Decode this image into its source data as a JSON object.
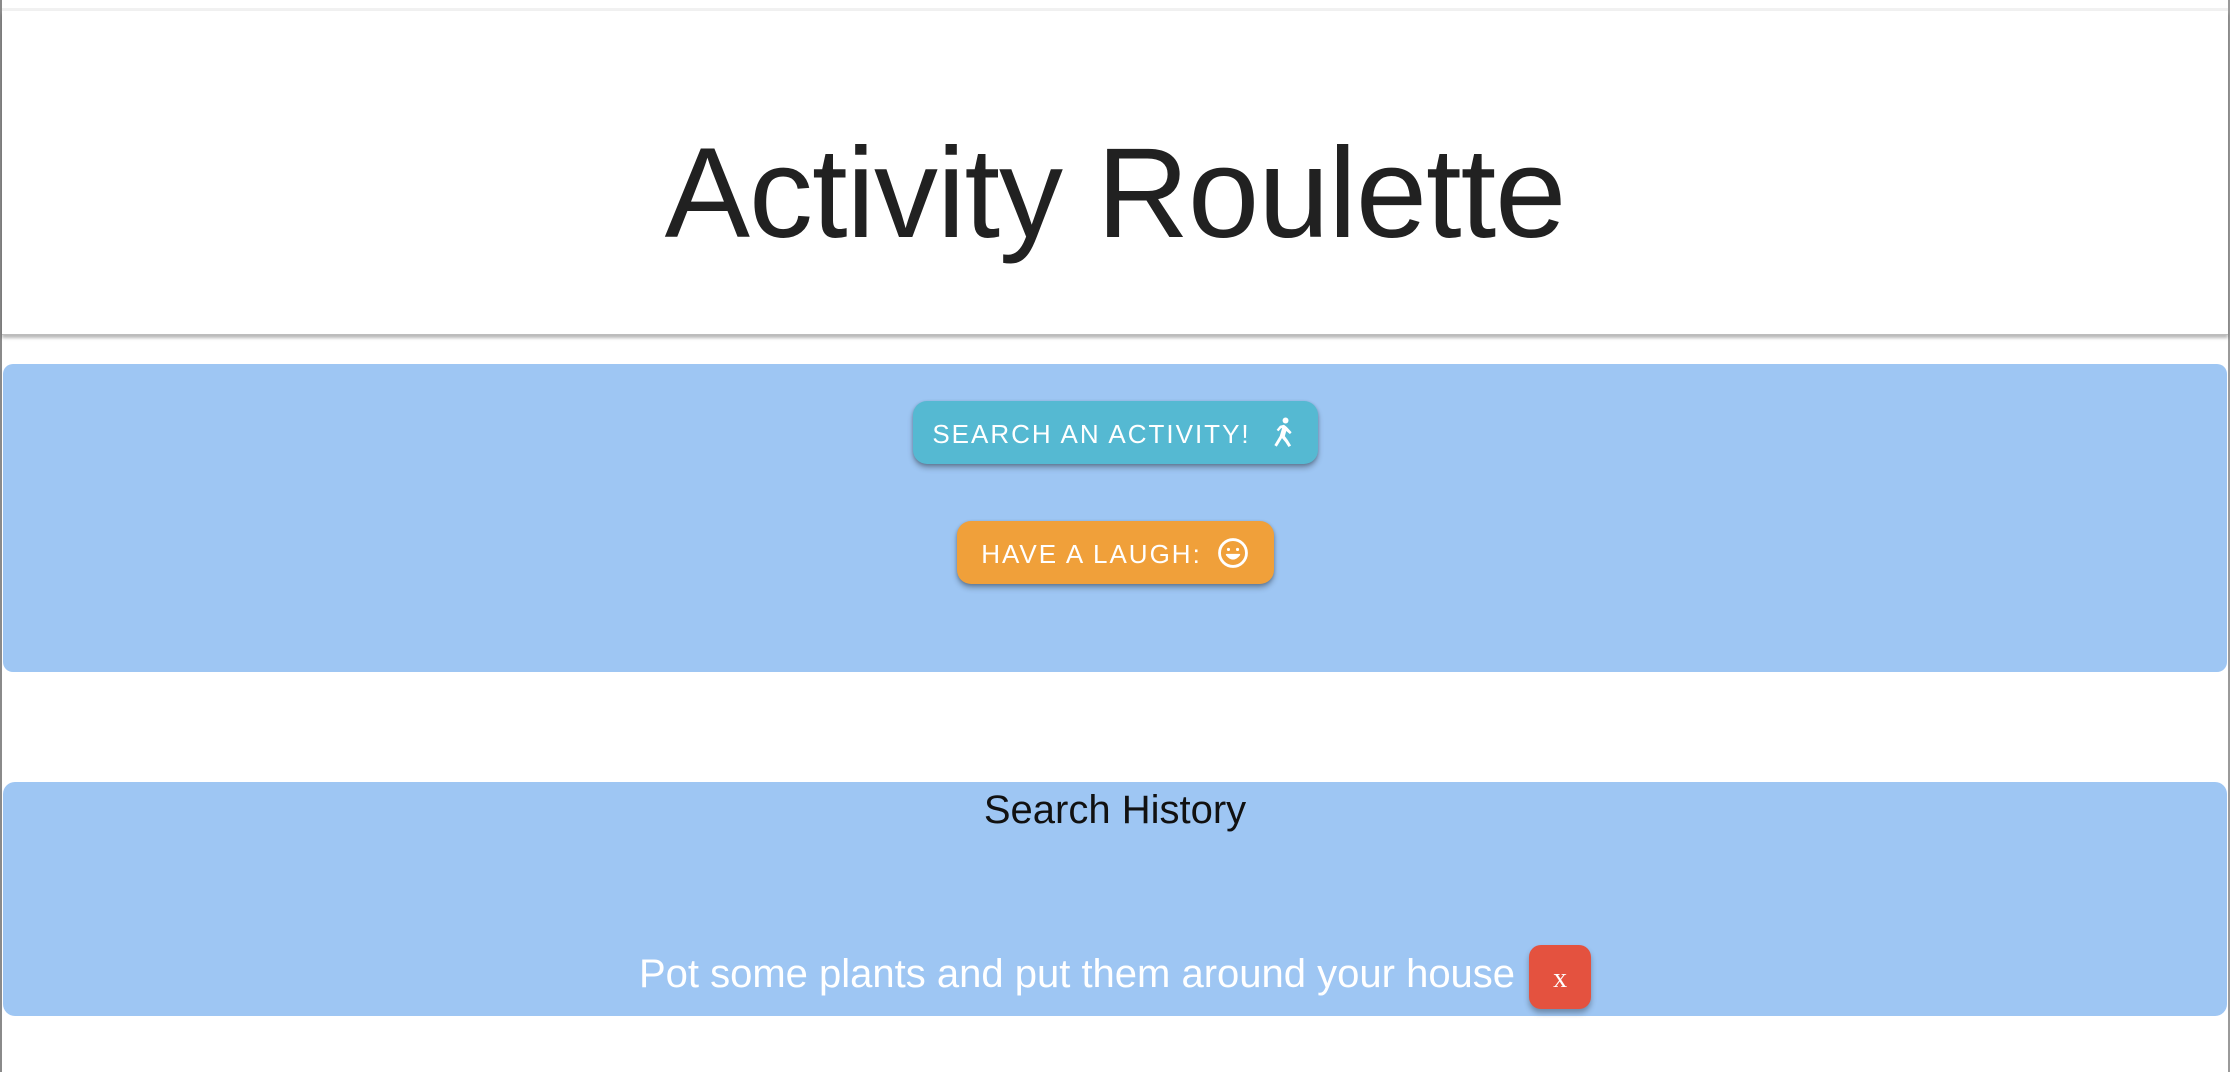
{
  "app": {
    "title": "Activity Roulette"
  },
  "actions": {
    "search_label": "Search an activity!",
    "search_icon": "person-walking-icon",
    "laugh_label": "Have a laugh:",
    "laugh_icon": "smiley-face-icon"
  },
  "history": {
    "title": "Search History",
    "items": [
      {
        "text": "Pot some plants and put them around your house",
        "remove_label": "x"
      }
    ]
  },
  "colors": {
    "panel": "#9ec6f3",
    "search_button": "#55b9d2",
    "laugh_button": "#f0a03a",
    "remove_button": "#e4523f",
    "title_text": "#212121"
  }
}
